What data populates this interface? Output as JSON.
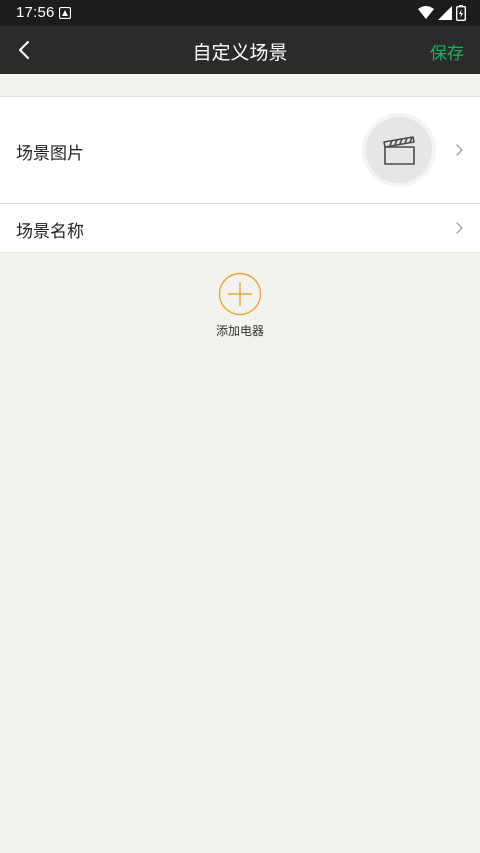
{
  "status_bar": {
    "time": "17:56"
  },
  "header": {
    "title": "自定义场景",
    "save_label": "保存"
  },
  "settings": {
    "scene_image_label": "场景图片",
    "scene_name_label": "场景名称"
  },
  "add_device": {
    "label": "添加电器"
  },
  "colors": {
    "accent_save": "#17b55a",
    "add_circle": "#e8a53a",
    "header_bg": "#2b2b2b",
    "page_bg": "#f3f3ee"
  },
  "icons": {
    "back": "chevron-left-icon",
    "scene_image": "clapperboard-icon",
    "chevron": "chevron-right-icon",
    "add": "plus-circle-icon"
  }
}
